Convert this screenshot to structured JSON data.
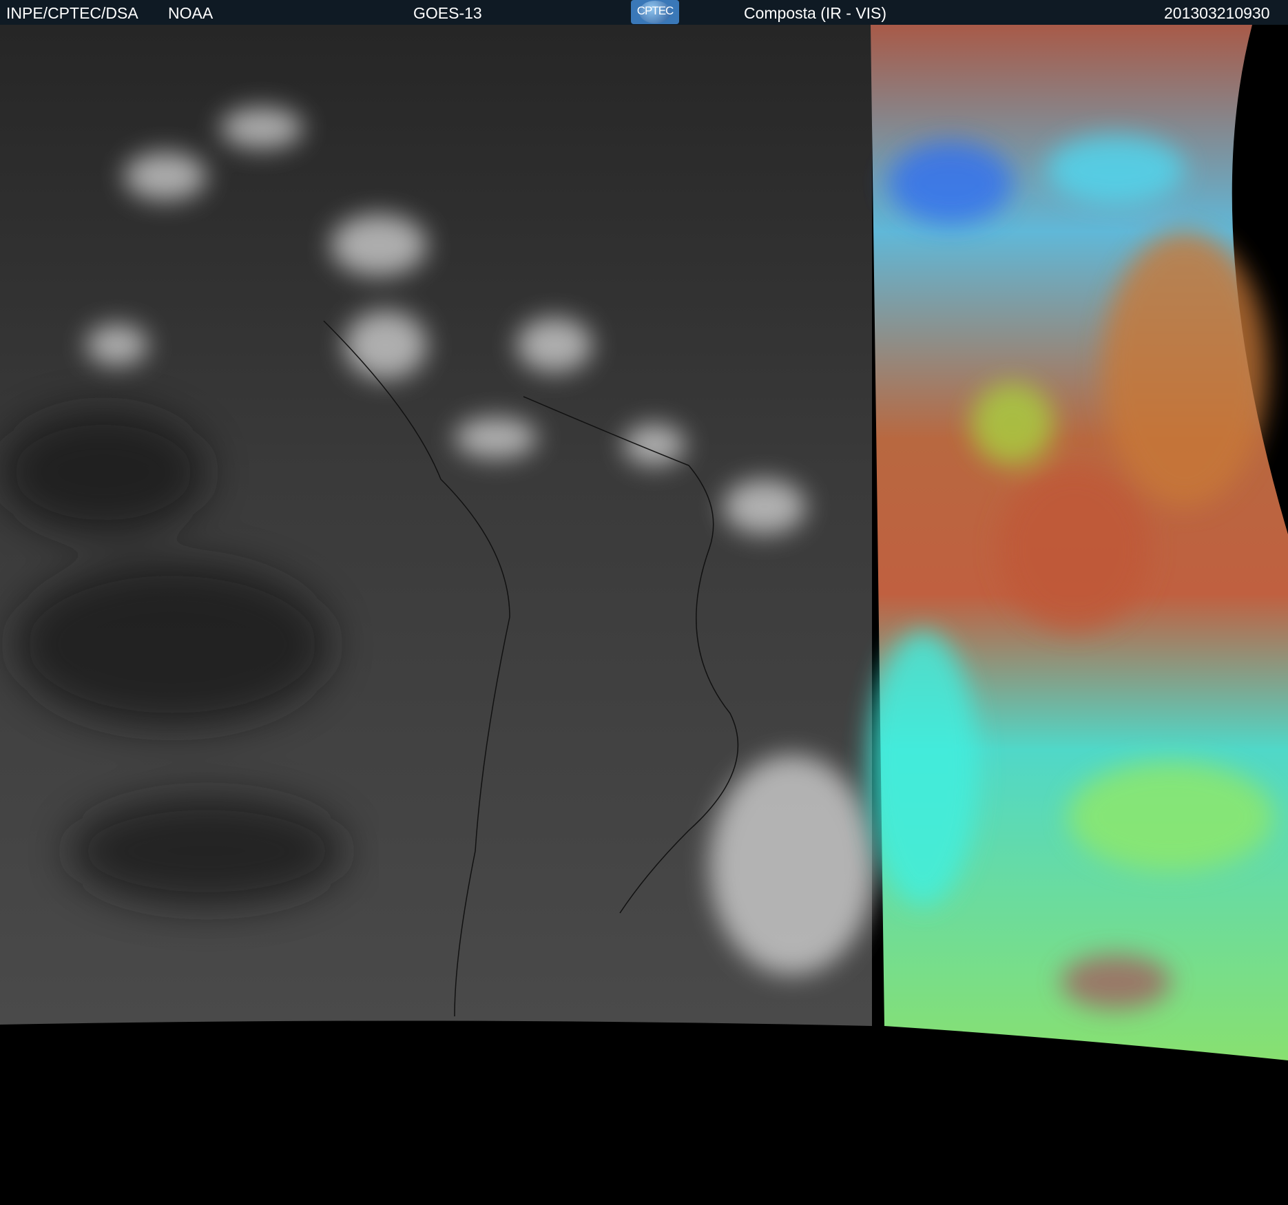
{
  "header": {
    "agency": "INPE/CPTEC/DSA",
    "source": "NOAA",
    "satellite": "GOES-13",
    "logo_text": "CPTEC",
    "product": "Composta (IR - VIS)",
    "timestamp": "201303210930"
  },
  "colors": {
    "header_bg": "#0f1a24",
    "ir_gray": "#3c3c3c",
    "vis_red": "#b0583c",
    "vis_green": "#8ee060",
    "vis_cyan": "#40e8e0",
    "vis_blue": "#3060e8"
  }
}
